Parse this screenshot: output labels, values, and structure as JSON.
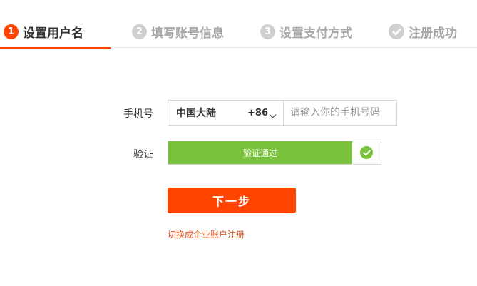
{
  "steps": [
    {
      "num": "1",
      "label": "设置用户名",
      "state": "active"
    },
    {
      "num": "2",
      "label": "填写账号信息",
      "state": "inactive"
    },
    {
      "num": "3",
      "label": "设置支付方式",
      "state": "inactive"
    },
    {
      "num": "",
      "label": "注册成功",
      "state": "inactive",
      "icon": "check-icon"
    }
  ],
  "form": {
    "phone_label": "手机号",
    "region_name": "中国大陆",
    "region_code": "+86",
    "phone_placeholder": "请输入你的手机号码",
    "phone_value": "",
    "verify_label": "验证",
    "verify_status": "验证通过",
    "verify_icon": "check-circle-icon",
    "next_button": "下一步",
    "switch_link": "切换成企业账户注册"
  },
  "colors": {
    "accent": "#ff4400",
    "success": "#7ac23c",
    "link": "#e5511d",
    "inactive": "#cfcfcf"
  }
}
